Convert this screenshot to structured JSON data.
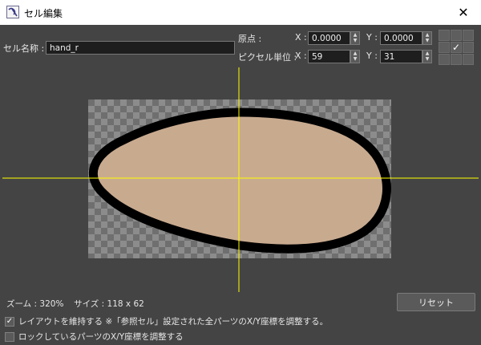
{
  "window": {
    "title": "セル編集",
    "close_glyph": "✕"
  },
  "cell_name": {
    "label": "セル名称 :",
    "value": "hand_r"
  },
  "origin": {
    "label": "原点 :",
    "x_label": "X :",
    "x_value": "0.0000",
    "y_label": "Y :",
    "y_value": "0.0000"
  },
  "pixel_unit": {
    "label": "ピクセル単位 :",
    "x_label": "X :",
    "x_value": "59",
    "y_label": "Y :",
    "y_value": "31"
  },
  "anchor": {
    "selected": 4,
    "check_glyph": "✓"
  },
  "status": {
    "zoom_label": "ズーム :",
    "zoom": "320%",
    "size_label": "サイズ :",
    "size": "118 x 62"
  },
  "reset_label": "リセット",
  "options": [
    {
      "label": "レイアウトを維持する ※「参照セル」設定された全パーツのX/Y座標を調整する。",
      "checked": true
    },
    {
      "label": "ロックしているパーツのX/Y座標を調整する",
      "checked": false
    }
  ],
  "colors": {
    "crosshair": "#ffff00",
    "fill": "#c8aa8f",
    "outline": "#000000",
    "checker_light": "#8c8c8c",
    "checker_dark": "#6f6f6f"
  }
}
